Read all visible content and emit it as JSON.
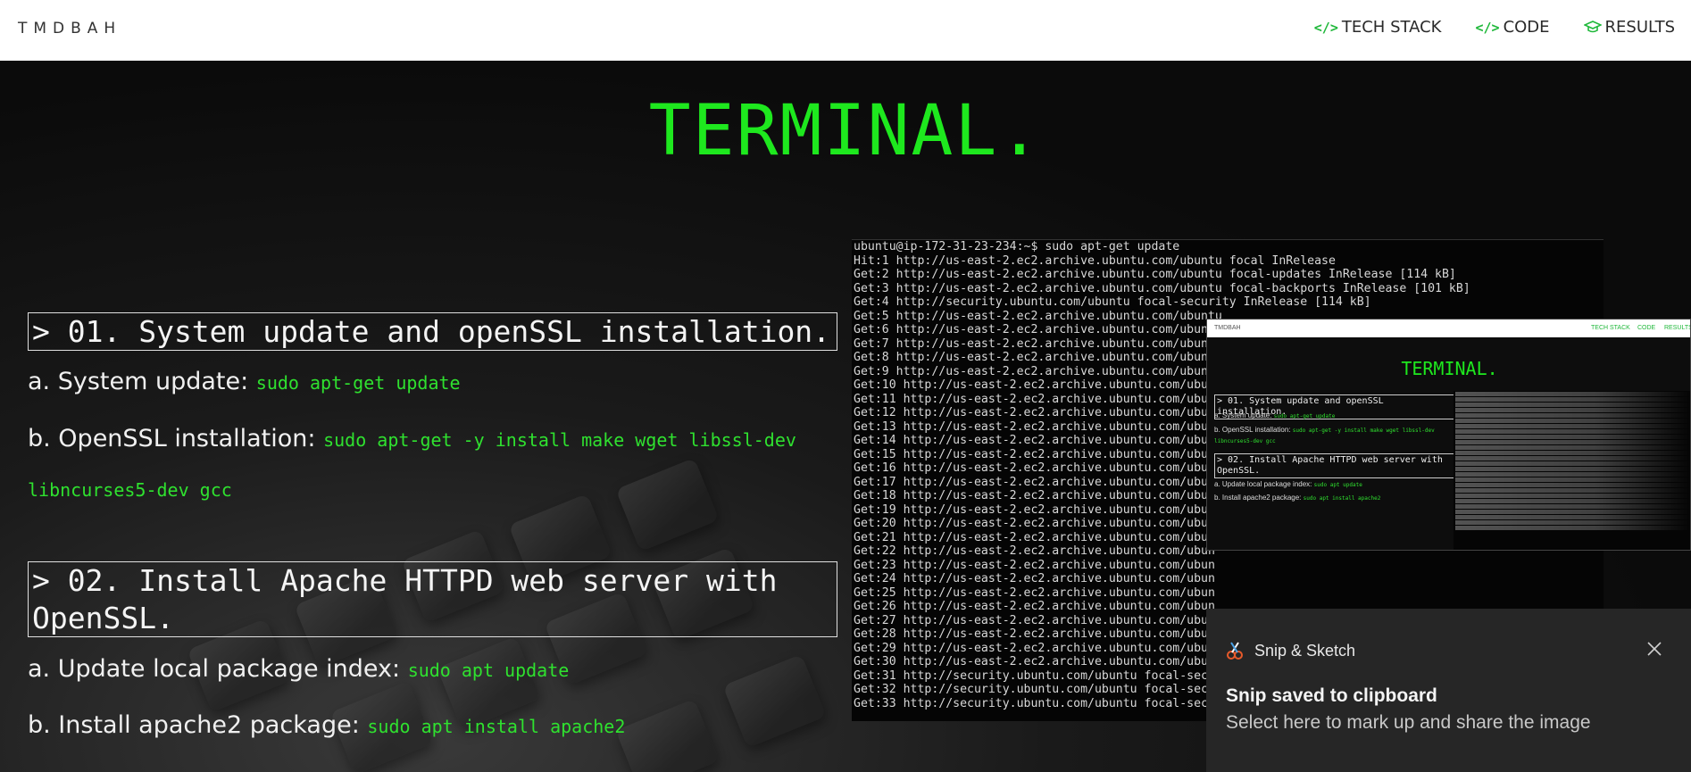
{
  "nav": {
    "brand": "TMDBAH",
    "links": [
      {
        "label": "TECH STACK",
        "icon": "code-icon"
      },
      {
        "label": "CODE",
        "icon": "code-icon"
      },
      {
        "label": "RESULTS",
        "icon": "graduation-cap-icon"
      }
    ]
  },
  "hero": {
    "title": "TERMINAL."
  },
  "steps": [
    {
      "heading": "> 01. System update and openSSL installation.",
      "items": [
        {
          "label": "a. System update: ",
          "command": "sudo apt-get update"
        },
        {
          "label": "b. OpenSSL installation: ",
          "command": "sudo apt-get -y install make wget libssl-dev",
          "command_cont": "libncurses5-dev gcc"
        }
      ]
    },
    {
      "heading_line1": "> 02. Install Apache HTTPD web server with",
      "heading_line2": "OpenSSL.",
      "items": [
        {
          "label": "a. Update local package index: ",
          "command": "sudo apt update"
        },
        {
          "label": "b. Install apache2 package: ",
          "command": "sudo apt install apache2"
        }
      ]
    }
  ],
  "terminal": {
    "lines": [
      "ubuntu@ip-172-31-23-234:~$ sudo apt-get update",
      "Hit:1 http://us-east-2.ec2.archive.ubuntu.com/ubuntu focal InRelease",
      "Get:2 http://us-east-2.ec2.archive.ubuntu.com/ubuntu focal-updates InRelease [114 kB]",
      "Get:3 http://us-east-2.ec2.archive.ubuntu.com/ubuntu focal-backports InRelease [101 kB]",
      "Get:4 http://security.ubuntu.com/ubuntu focal-security InRelease [114 kB]",
      "Get:5 http://us-east-2.ec2.archive.ubuntu.com/ubuntu",
      "Get:6 http://us-east-2.ec2.archive.ubuntu.com/ubunt",
      "Get:7 http://us-east-2.ec2.archive.ubuntu.com/ubunt",
      "Get:8 http://us-east-2.ec2.archive.ubuntu.com/ubunt",
      "Get:9 http://us-east-2.ec2.archive.ubuntu.com/ubunt",
      "Get:10 http://us-east-2.ec2.archive.ubuntu.com/ubun",
      "Get:11 http://us-east-2.ec2.archive.ubuntu.com/ubun",
      "Get:12 http://us-east-2.ec2.archive.ubuntu.com/ubun",
      "Get:13 http://us-east-2.ec2.archive.ubuntu.com/ubun",
      "Get:14 http://us-east-2.ec2.archive.ubuntu.com/ubun",
      "Get:15 http://us-east-2.ec2.archive.ubuntu.com/ubun",
      "Get:16 http://us-east-2.ec2.archive.ubuntu.com/ubun",
      "Get:17 http://us-east-2.ec2.archive.ubuntu.com/ubun",
      "Get:18 http://us-east-2.ec2.archive.ubuntu.com/ubun",
      "Get:19 http://us-east-2.ec2.archive.ubuntu.com/ubun",
      "Get:20 http://us-east-2.ec2.archive.ubuntu.com/ubun",
      "Get:21 http://us-east-2.ec2.archive.ubuntu.com/ubun",
      "Get:22 http://us-east-2.ec2.archive.ubuntu.com/ubun",
      "Get:23 http://us-east-2.ec2.archive.ubuntu.com/ubun",
      "Get:24 http://us-east-2.ec2.archive.ubuntu.com/ubun",
      "Get:25 http://us-east-2.ec2.archive.ubuntu.com/ubun",
      "Get:26 http://us-east-2.ec2.archive.ubuntu.com/ubun",
      "Get:27 http://us-east-2.ec2.archive.ubuntu.com/ubun",
      "Get:28 http://us-east-2.ec2.archive.ubuntu.com/ubun",
      "Get:29 http://us-east-2.ec2.archive.ubuntu.com/ubun",
      "Get:30 http://us-east-2.ec2.archive.ubuntu.com/ubun",
      "Get:31 http://security.ubuntu.com/ubuntu focal-secu",
      "Get:32 http://security.ubuntu.com/ubuntu focal-secu",
      "Get:33 http://security.ubuntu.com/ubuntu focal-secu"
    ]
  },
  "preview": {
    "title": "TERMINAL.",
    "box1": "> 01. System update and openSSL installation.",
    "line_a_label": "a. System update:",
    "line_a_cmd": "sudo apt-get update",
    "line_b_label": "b. OpenSSL installation:",
    "line_b_cmd": "sudo apt-get -y install make wget libssl-dev",
    "line_b_cont": "libncurses5-dev gcc",
    "box2": "> 02. Install Apache HTTPD web server with OpenSSL.",
    "line_c_label": "a. Update local package index:",
    "line_c_cmd": "sudo apt update",
    "line_d_label": "b. Install apache2 package:",
    "line_d_cmd": "sudo apt install apache2"
  },
  "toast": {
    "app": "Snip & Sketch",
    "title": "Snip saved to clipboard",
    "body": "Select here to mark up and share the image"
  },
  "colors": {
    "accent_green": "#1ee81e",
    "command_green": "#2fe12f",
    "nav_icon_green": "#1fb83a",
    "toast_bg": "#262626"
  }
}
